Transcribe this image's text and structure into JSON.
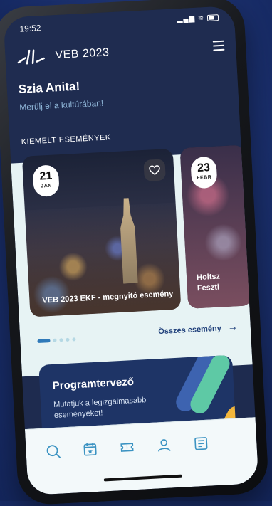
{
  "status_bar": {
    "time": "19:52"
  },
  "header": {
    "app_title": "VEB 2023"
  },
  "greeting": {
    "title": "Szia Anita!",
    "subtitle": "Merülj el a kultúrában!"
  },
  "featured": {
    "section_title": "KIEMELT ESEMÉNYEK",
    "events": [
      {
        "day": "21",
        "month": "JAN",
        "title": "VEB 2023 EKF - megnyitó esemény"
      },
      {
        "day": "23",
        "month": "FEBR",
        "title_line1": "Holtsz",
        "title_line2": "Feszti"
      }
    ],
    "all_events_label": "Összes esemény",
    "page_count": 5,
    "active_page": 1
  },
  "planner": {
    "title": "Programtervező",
    "description": "Mutatjuk a legizgalmasabb eseményeket!"
  },
  "tabbar": {
    "items": [
      {
        "icon": "search-icon"
      },
      {
        "icon": "calendar-icon"
      },
      {
        "icon": "ticket-icon"
      },
      {
        "icon": "profile-icon"
      },
      {
        "icon": "news-icon"
      }
    ],
    "icon_color": "#3b93c2"
  },
  "colors": {
    "brand_navy": "#1f2c50",
    "accent_blue": "#2f79b9",
    "accent_green": "#5ec9a5",
    "accent_yellow": "#f2b63c"
  }
}
